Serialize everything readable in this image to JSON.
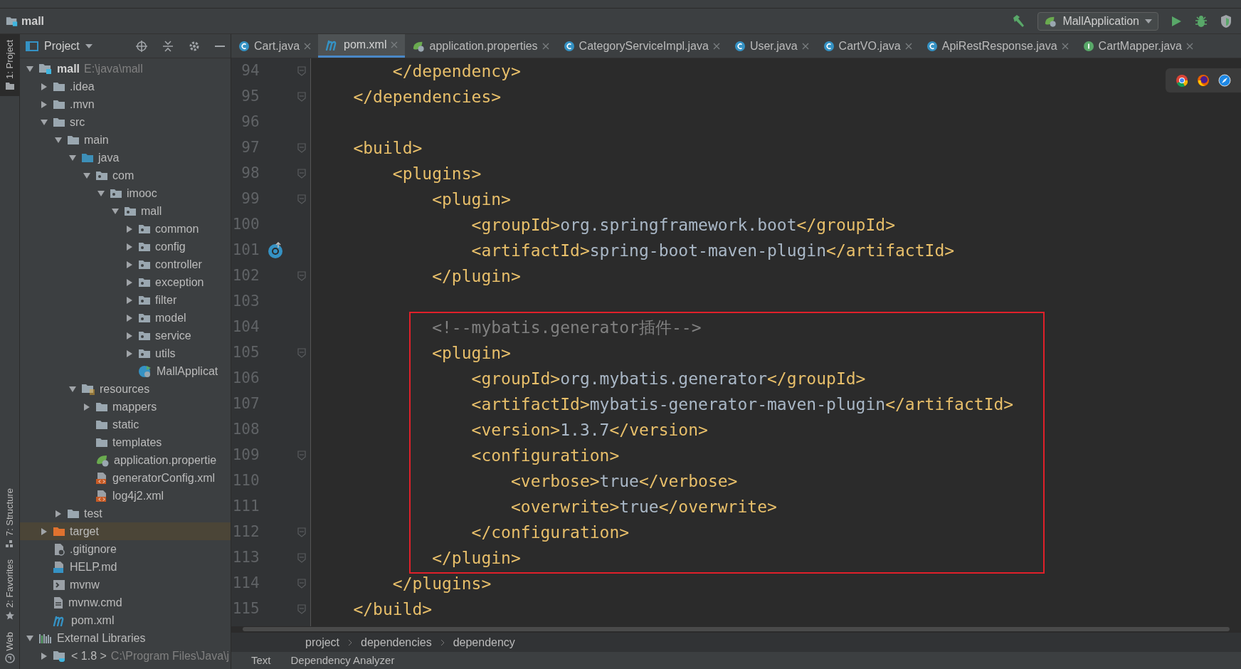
{
  "project": {
    "name": "mall"
  },
  "run_config": {
    "label": "MallApplication"
  },
  "project_panel": {
    "title": "Project"
  },
  "tabs": [
    {
      "label": "Cart.java",
      "kind": "class",
      "selected": false
    },
    {
      "label": "pom.xml",
      "kind": "maven",
      "selected": true
    },
    {
      "label": "application.properties",
      "kind": "spring",
      "selected": false
    },
    {
      "label": "CategoryServiceImpl.java",
      "kind": "class",
      "selected": false
    },
    {
      "label": "User.java",
      "kind": "class",
      "selected": false
    },
    {
      "label": "CartVO.java",
      "kind": "class",
      "selected": false
    },
    {
      "label": "ApiRestResponse.java",
      "kind": "class",
      "selected": false
    },
    {
      "label": "CartMapper.java",
      "kind": "interface",
      "selected": false
    }
  ],
  "tool_strip": [
    {
      "label": "1: Project",
      "kind": "folder",
      "selected": true
    },
    {
      "label": "7: Structure",
      "kind": "structure",
      "selected": false
    },
    {
      "label": "2: Favorites",
      "kind": "star",
      "selected": false
    },
    {
      "label": "Web",
      "kind": "web",
      "selected": false
    }
  ],
  "tree": [
    {
      "label": "mall",
      "path": "E:\\java\\mall",
      "kind": "module",
      "expanded": true,
      "selected": false,
      "children": [
        {
          "label": ".idea",
          "kind": "folder",
          "expanded": false,
          "selected": false
        },
        {
          "label": ".mvn",
          "kind": "folder",
          "expanded": false,
          "selected": false
        },
        {
          "label": "src",
          "kind": "folder",
          "expanded": true,
          "selected": false,
          "children": [
            {
              "label": "main",
              "kind": "folder",
              "expanded": true,
              "selected": false,
              "children": [
                {
                  "label": "java",
                  "kind": "source",
                  "expanded": true,
                  "selected": false,
                  "children": [
                    {
                      "label": "com",
                      "kind": "package",
                      "expanded": true,
                      "selected": false,
                      "children": [
                        {
                          "label": "imooc",
                          "kind": "package",
                          "expanded": true,
                          "selected": false,
                          "children": [
                            {
                              "label": "mall",
                              "kind": "package",
                              "expanded": true,
                              "selected": false,
                              "children": [
                                {
                                  "label": "common",
                                  "kind": "package",
                                  "expanded": false,
                                  "selected": false
                                },
                                {
                                  "label": "config",
                                  "kind": "package",
                                  "expanded": false,
                                  "selected": false
                                },
                                {
                                  "label": "controller",
                                  "kind": "package",
                                  "expanded": false,
                                  "selected": false
                                },
                                {
                                  "label": "exception",
                                  "kind": "package",
                                  "expanded": false,
                                  "selected": false
                                },
                                {
                                  "label": "filter",
                                  "kind": "package",
                                  "expanded": false,
                                  "selected": false
                                },
                                {
                                  "label": "model",
                                  "kind": "package",
                                  "expanded": false,
                                  "selected": false
                                },
                                {
                                  "label": "service",
                                  "kind": "package",
                                  "expanded": false,
                                  "selected": false
                                },
                                {
                                  "label": "utils",
                                  "kind": "package",
                                  "expanded": false,
                                  "selected": false
                                },
                                {
                                  "label": "MallApplicat",
                                  "kind": "spring-class",
                                  "selected": false
                                }
                              ]
                            }
                          ]
                        }
                      ]
                    }
                  ]
                },
                {
                  "label": "resources",
                  "kind": "resources",
                  "expanded": true,
                  "selected": false,
                  "children": [
                    {
                      "label": "mappers",
                      "kind": "folder",
                      "expanded": false,
                      "selected": false
                    },
                    {
                      "label": "static",
                      "kind": "folder",
                      "selected": false
                    },
                    {
                      "label": "templates",
                      "kind": "folder",
                      "selected": false
                    },
                    {
                      "label": "application.propertie",
                      "kind": "spring-props",
                      "selected": false
                    },
                    {
                      "label": "generatorConfig.xml",
                      "kind": "xml",
                      "selected": false
                    },
                    {
                      "label": "log4j2.xml",
                      "kind": "xml",
                      "selected": false
                    }
                  ]
                }
              ]
            },
            {
              "label": "test",
              "kind": "folder",
              "expanded": false,
              "selected": false
            }
          ]
        },
        {
          "label": "target",
          "kind": "excluded",
          "expanded": false,
          "selected": true
        },
        {
          "label": ".gitignore",
          "kind": "gitignore",
          "selected": false
        },
        {
          "label": "HELP.md",
          "kind": "md",
          "selected": false
        },
        {
          "label": "mvnw",
          "kind": "script",
          "selected": false
        },
        {
          "label": "mvnw.cmd",
          "kind": "text",
          "selected": false
        },
        {
          "label": "pom.xml",
          "kind": "maven",
          "selected": false
        }
      ]
    },
    {
      "label": "External Libraries",
      "kind": "libs",
      "expanded": true,
      "selected": false,
      "children": [
        {
          "label": "< 1.8 >",
          "path": "C:\\Program Files\\Java\\j",
          "kind": "jdk",
          "expanded": false,
          "selected": false
        }
      ]
    }
  ],
  "code": [
    {
      "number": "94",
      "code": "        </dependency>",
      "fold": true,
      "highlighted": false
    },
    {
      "number": "95",
      "code": "    </dependencies>",
      "fold": true,
      "highlighted": false
    },
    {
      "number": "96",
      "fold": false,
      "highlighted": false
    },
    {
      "number": "97",
      "code": "    <build>",
      "fold": true,
      "highlighted": false
    },
    {
      "number": "98",
      "code": "        <plugins>",
      "fold": true,
      "highlighted": false
    },
    {
      "number": "99",
      "code": "            <plugin>",
      "fold": true,
      "highlighted": false
    },
    {
      "number": "100",
      "code": "                <groupId>org.springframework.boot</groupId>",
      "fold": false,
      "highlighted": false
    },
    {
      "number": "101",
      "code": "                <artifactId>spring-boot-maven-plugin</artifactId>",
      "fold": false,
      "run_marker": true,
      "highlighted": false
    },
    {
      "number": "102",
      "code": "            </plugin>",
      "fold": true,
      "highlighted": false
    },
    {
      "number": "103",
      "fold": false,
      "highlighted": false
    },
    {
      "number": "104",
      "code": "            <!--mybatis.generator插件-->",
      "fold": false,
      "highlighted": true
    },
    {
      "number": "105",
      "code": "            <plugin>",
      "fold": true,
      "highlighted": true
    },
    {
      "number": "106",
      "code": "                <groupId>org.mybatis.generator</groupId>",
      "fold": false,
      "highlighted": true
    },
    {
      "number": "107",
      "code": "                <artifactId>mybatis-generator-maven-plugin</artifactId>",
      "fold": false,
      "highlighted": true
    },
    {
      "number": "108",
      "code": "                <version>1.3.7</version>",
      "fold": false,
      "highlighted": true
    },
    {
      "number": "109",
      "code": "                <configuration>",
      "fold": true,
      "highlighted": true
    },
    {
      "number": "110",
      "code": "                    <verbose>true</verbose>",
      "fold": false,
      "highlighted": true
    },
    {
      "number": "111",
      "code": "                    <overwrite>true</overwrite>",
      "fold": false,
      "highlighted": true
    },
    {
      "number": "112",
      "code": "                </configuration>",
      "fold": true,
      "highlighted": true
    },
    {
      "number": "113",
      "code": "            </plugin>",
      "fold": true,
      "highlighted": true
    },
    {
      "number": "114",
      "code": "        </plugins>",
      "fold": true,
      "highlighted": false
    },
    {
      "number": "115",
      "code": "    </build>",
      "fold": true,
      "highlighted": false
    }
  ],
  "breadcrumb": [
    "project",
    "dependencies",
    "dependency"
  ],
  "bottom_tabs": [
    {
      "label": "Text",
      "selected": false
    },
    {
      "label": "Dependency Analyzer",
      "selected": false
    }
  ]
}
